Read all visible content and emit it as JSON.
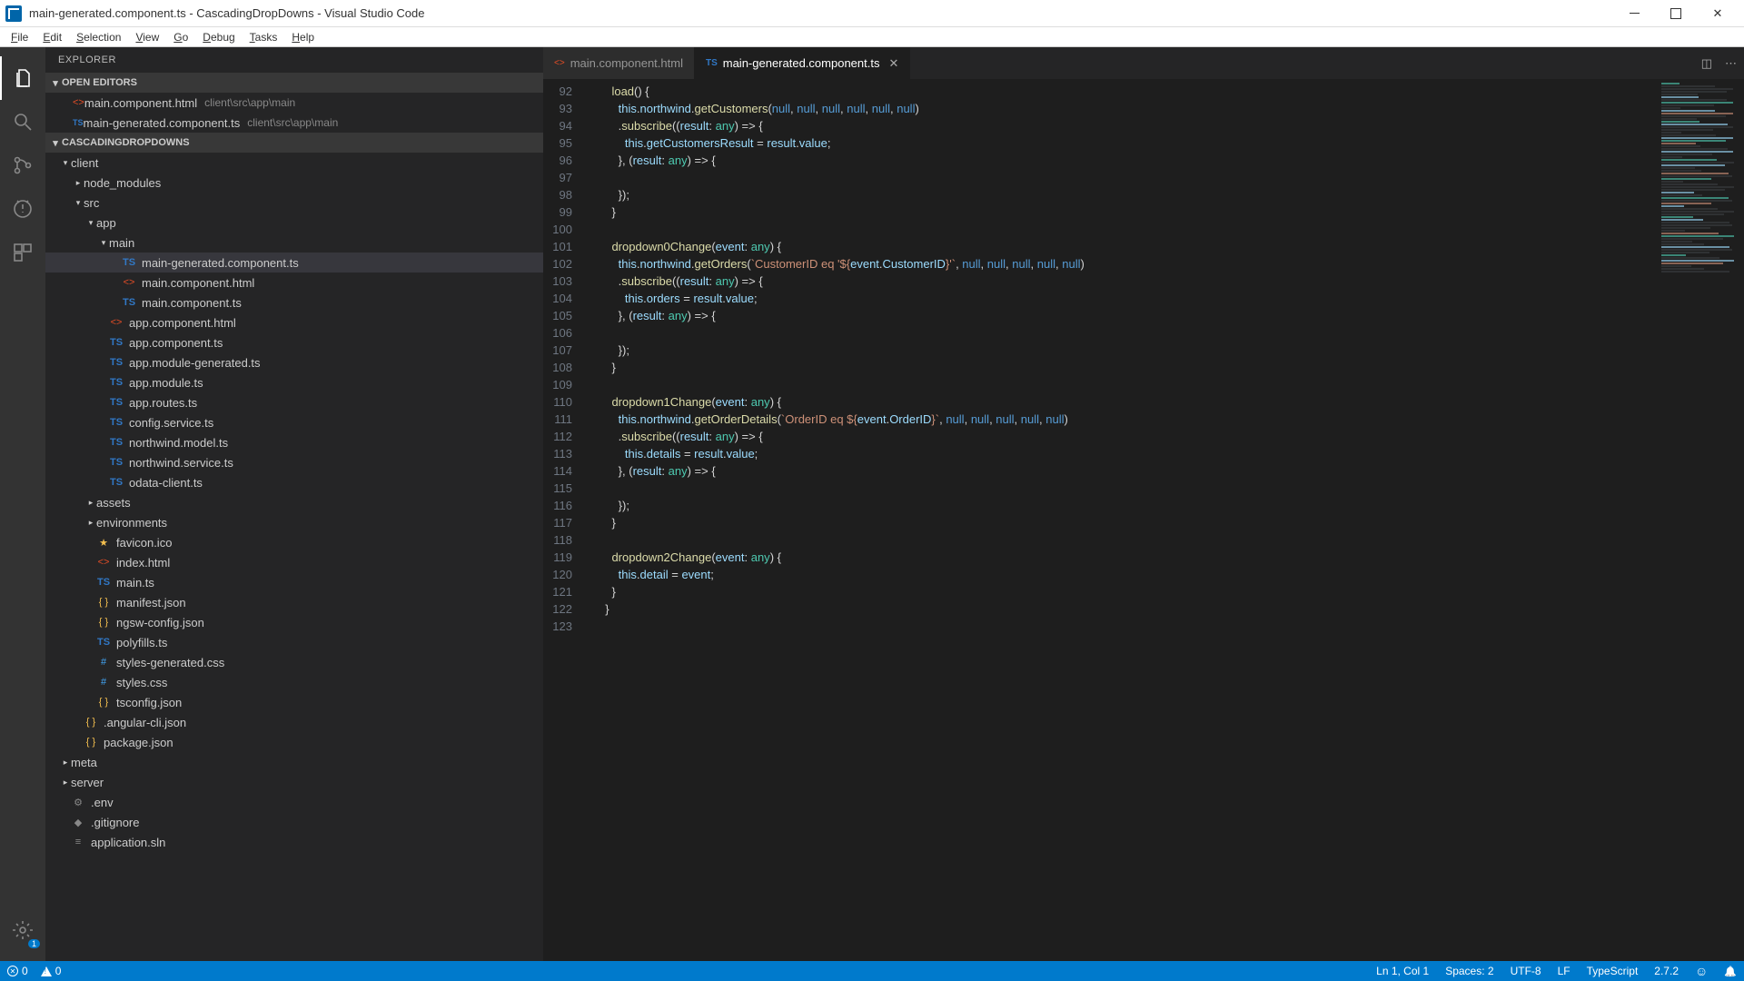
{
  "window": {
    "title": "main-generated.component.ts - CascadingDropDowns - Visual Studio Code"
  },
  "menubar": [
    "File",
    "Edit",
    "Selection",
    "View",
    "Go",
    "Debug",
    "Tasks",
    "Help"
  ],
  "activitybar": {
    "gear_badge": "1"
  },
  "sidebar": {
    "title": "EXPLORER",
    "open_editors_label": "OPEN EDITORS",
    "open_editors": [
      {
        "icon": "html",
        "name": "main.component.html",
        "desc": "client\\src\\app\\main"
      },
      {
        "icon": "ts",
        "name": "main-generated.component.ts",
        "desc": "client\\src\\app\\main"
      }
    ],
    "project_label": "CASCADINGDROPDOWNS",
    "tree": [
      {
        "indent": 0,
        "twisty": "▾",
        "icon": "",
        "name": "client",
        "kind": "folder"
      },
      {
        "indent": 1,
        "twisty": "▸",
        "icon": "",
        "name": "node_modules",
        "kind": "folder"
      },
      {
        "indent": 1,
        "twisty": "▾",
        "icon": "",
        "name": "src",
        "kind": "folder"
      },
      {
        "indent": 2,
        "twisty": "▾",
        "icon": "",
        "name": "app",
        "kind": "folder"
      },
      {
        "indent": 3,
        "twisty": "▾",
        "icon": "",
        "name": "main",
        "kind": "folder"
      },
      {
        "indent": 4,
        "twisty": "",
        "icon": "ts",
        "name": "main-generated.component.ts",
        "kind": "file",
        "active": true
      },
      {
        "indent": 4,
        "twisty": "",
        "icon": "html",
        "name": "main.component.html",
        "kind": "file"
      },
      {
        "indent": 4,
        "twisty": "",
        "icon": "ts",
        "name": "main.component.ts",
        "kind": "file"
      },
      {
        "indent": 3,
        "twisty": "",
        "icon": "html",
        "name": "app.component.html",
        "kind": "file"
      },
      {
        "indent": 3,
        "twisty": "",
        "icon": "ts",
        "name": "app.component.ts",
        "kind": "file"
      },
      {
        "indent": 3,
        "twisty": "",
        "icon": "ts",
        "name": "app.module-generated.ts",
        "kind": "file"
      },
      {
        "indent": 3,
        "twisty": "",
        "icon": "ts",
        "name": "app.module.ts",
        "kind": "file"
      },
      {
        "indent": 3,
        "twisty": "",
        "icon": "ts",
        "name": "app.routes.ts",
        "kind": "file"
      },
      {
        "indent": 3,
        "twisty": "",
        "icon": "ts",
        "name": "config.service.ts",
        "kind": "file"
      },
      {
        "indent": 3,
        "twisty": "",
        "icon": "ts",
        "name": "northwind.model.ts",
        "kind": "file"
      },
      {
        "indent": 3,
        "twisty": "",
        "icon": "ts",
        "name": "northwind.service.ts",
        "kind": "file"
      },
      {
        "indent": 3,
        "twisty": "",
        "icon": "ts",
        "name": "odata-client.ts",
        "kind": "file"
      },
      {
        "indent": 2,
        "twisty": "▸",
        "icon": "",
        "name": "assets",
        "kind": "folder"
      },
      {
        "indent": 2,
        "twisty": "▸",
        "icon": "",
        "name": "environments",
        "kind": "folder"
      },
      {
        "indent": 2,
        "twisty": "",
        "icon": "star",
        "name": "favicon.ico",
        "kind": "file"
      },
      {
        "indent": 2,
        "twisty": "",
        "icon": "html",
        "name": "index.html",
        "kind": "file"
      },
      {
        "indent": 2,
        "twisty": "",
        "icon": "ts",
        "name": "main.ts",
        "kind": "file"
      },
      {
        "indent": 2,
        "twisty": "",
        "icon": "json",
        "name": "manifest.json",
        "kind": "file"
      },
      {
        "indent": 2,
        "twisty": "",
        "icon": "json",
        "name": "ngsw-config.json",
        "kind": "file"
      },
      {
        "indent": 2,
        "twisty": "",
        "icon": "ts",
        "name": "polyfills.ts",
        "kind": "file"
      },
      {
        "indent": 2,
        "twisty": "",
        "icon": "css",
        "name": "styles-generated.css",
        "kind": "file"
      },
      {
        "indent": 2,
        "twisty": "",
        "icon": "css",
        "name": "styles.css",
        "kind": "file"
      },
      {
        "indent": 2,
        "twisty": "",
        "icon": "json",
        "name": "tsconfig.json",
        "kind": "file"
      },
      {
        "indent": 1,
        "twisty": "",
        "icon": "json",
        "name": ".angular-cli.json",
        "kind": "file"
      },
      {
        "indent": 1,
        "twisty": "",
        "icon": "json",
        "name": "package.json",
        "kind": "file"
      },
      {
        "indent": 0,
        "twisty": "▸",
        "icon": "",
        "name": "meta",
        "kind": "folder"
      },
      {
        "indent": 0,
        "twisty": "▸",
        "icon": "",
        "name": "server",
        "kind": "folder"
      },
      {
        "indent": 0,
        "twisty": "",
        "icon": "env",
        "name": ".env",
        "kind": "file"
      },
      {
        "indent": 0,
        "twisty": "",
        "icon": "git",
        "name": ".gitignore",
        "kind": "file"
      },
      {
        "indent": 0,
        "twisty": "",
        "icon": "sln",
        "name": "application.sln",
        "kind": "file"
      }
    ]
  },
  "tabs": [
    {
      "icon": "html",
      "name": "main.component.html",
      "active": false
    },
    {
      "icon": "ts",
      "name": "main-generated.component.ts",
      "active": true
    }
  ],
  "editor": {
    "first_line_no": 92,
    "lines": [
      {
        "t": [
          [
            "p",
            "    "
          ],
          [
            "fn",
            "load"
          ],
          [
            "p",
            "() {"
          ]
        ]
      },
      {
        "t": [
          [
            "p",
            "      "
          ],
          [
            "this",
            "this"
          ],
          [
            "p",
            "."
          ],
          [
            "v",
            "northwind"
          ],
          [
            "p",
            "."
          ],
          [
            "fn",
            "getCustomers"
          ],
          [
            "p",
            "("
          ],
          [
            "null",
            "null"
          ],
          [
            "p",
            ", "
          ],
          [
            "null",
            "null"
          ],
          [
            "p",
            ", "
          ],
          [
            "null",
            "null"
          ],
          [
            "p",
            ", "
          ],
          [
            "null",
            "null"
          ],
          [
            "p",
            ", "
          ],
          [
            "null",
            "null"
          ],
          [
            "p",
            ", "
          ],
          [
            "null",
            "null"
          ],
          [
            "p",
            ")"
          ]
        ]
      },
      {
        "t": [
          [
            "p",
            "      ."
          ],
          [
            "fn",
            "subscribe"
          ],
          [
            "p",
            "(("
          ],
          [
            "v",
            "result"
          ],
          [
            "p",
            ": "
          ],
          [
            "type",
            "any"
          ],
          [
            "p",
            ") => {"
          ]
        ]
      },
      {
        "t": [
          [
            "p",
            "        "
          ],
          [
            "this",
            "this"
          ],
          [
            "p",
            "."
          ],
          [
            "v",
            "getCustomersResult"
          ],
          [
            "p",
            " = "
          ],
          [
            "v",
            "result"
          ],
          [
            "p",
            "."
          ],
          [
            "v",
            "value"
          ],
          [
            "p",
            ";"
          ]
        ]
      },
      {
        "t": [
          [
            "p",
            "      }, ("
          ],
          [
            "v",
            "result"
          ],
          [
            "p",
            ": "
          ],
          [
            "type",
            "any"
          ],
          [
            "p",
            ") => {"
          ]
        ]
      },
      {
        "t": [
          [
            "p",
            ""
          ]
        ]
      },
      {
        "t": [
          [
            "p",
            "      });"
          ]
        ]
      },
      {
        "t": [
          [
            "p",
            "    }"
          ]
        ]
      },
      {
        "t": [
          [
            "p",
            ""
          ]
        ]
      },
      {
        "t": [
          [
            "p",
            "    "
          ],
          [
            "fn",
            "dropdown0Change"
          ],
          [
            "p",
            "("
          ],
          [
            "v",
            "event"
          ],
          [
            "p",
            ": "
          ],
          [
            "type",
            "any"
          ],
          [
            "p",
            ") {"
          ]
        ]
      },
      {
        "t": [
          [
            "p",
            "      "
          ],
          [
            "this",
            "this"
          ],
          [
            "p",
            "."
          ],
          [
            "v",
            "northwind"
          ],
          [
            "p",
            "."
          ],
          [
            "fn",
            "getOrders"
          ],
          [
            "p",
            "("
          ],
          [
            "str",
            "`CustomerID eq '${"
          ],
          [
            "v",
            "event"
          ],
          [
            "p",
            "."
          ],
          [
            "v",
            "CustomerID"
          ],
          [
            "str",
            "}'`"
          ],
          [
            "p",
            ", "
          ],
          [
            "null",
            "null"
          ],
          [
            "p",
            ", "
          ],
          [
            "null",
            "null"
          ],
          [
            "p",
            ", "
          ],
          [
            "null",
            "null"
          ],
          [
            "p",
            ", "
          ],
          [
            "null",
            "null"
          ],
          [
            "p",
            ", "
          ],
          [
            "null",
            "null"
          ],
          [
            "p",
            ")"
          ]
        ]
      },
      {
        "t": [
          [
            "p",
            "      ."
          ],
          [
            "fn",
            "subscribe"
          ],
          [
            "p",
            "(("
          ],
          [
            "v",
            "result"
          ],
          [
            "p",
            ": "
          ],
          [
            "type",
            "any"
          ],
          [
            "p",
            ") => {"
          ]
        ]
      },
      {
        "t": [
          [
            "p",
            "        "
          ],
          [
            "this",
            "this"
          ],
          [
            "p",
            "."
          ],
          [
            "v",
            "orders"
          ],
          [
            "p",
            " = "
          ],
          [
            "v",
            "result"
          ],
          [
            "p",
            "."
          ],
          [
            "v",
            "value"
          ],
          [
            "p",
            ";"
          ]
        ]
      },
      {
        "t": [
          [
            "p",
            "      }, ("
          ],
          [
            "v",
            "result"
          ],
          [
            "p",
            ": "
          ],
          [
            "type",
            "any"
          ],
          [
            "p",
            ") => {"
          ]
        ]
      },
      {
        "t": [
          [
            "p",
            ""
          ]
        ]
      },
      {
        "t": [
          [
            "p",
            "      });"
          ]
        ]
      },
      {
        "t": [
          [
            "p",
            "    }"
          ]
        ]
      },
      {
        "t": [
          [
            "p",
            ""
          ]
        ]
      },
      {
        "t": [
          [
            "p",
            "    "
          ],
          [
            "fn",
            "dropdown1Change"
          ],
          [
            "p",
            "("
          ],
          [
            "v",
            "event"
          ],
          [
            "p",
            ": "
          ],
          [
            "type",
            "any"
          ],
          [
            "p",
            ") {"
          ]
        ]
      },
      {
        "t": [
          [
            "p",
            "      "
          ],
          [
            "this",
            "this"
          ],
          [
            "p",
            "."
          ],
          [
            "v",
            "northwind"
          ],
          [
            "p",
            "."
          ],
          [
            "fn",
            "getOrderDetails"
          ],
          [
            "p",
            "("
          ],
          [
            "str",
            "`OrderID eq ${"
          ],
          [
            "v",
            "event"
          ],
          [
            "p",
            "."
          ],
          [
            "v",
            "OrderID"
          ],
          [
            "str",
            "}`"
          ],
          [
            "p",
            ", "
          ],
          [
            "null",
            "null"
          ],
          [
            "p",
            ", "
          ],
          [
            "null",
            "null"
          ],
          [
            "p",
            ", "
          ],
          [
            "null",
            "null"
          ],
          [
            "p",
            ", "
          ],
          [
            "null",
            "null"
          ],
          [
            "p",
            ", "
          ],
          [
            "null",
            "null"
          ],
          [
            "p",
            ")"
          ]
        ]
      },
      {
        "t": [
          [
            "p",
            "      ."
          ],
          [
            "fn",
            "subscribe"
          ],
          [
            "p",
            "(("
          ],
          [
            "v",
            "result"
          ],
          [
            "p",
            ": "
          ],
          [
            "type",
            "any"
          ],
          [
            "p",
            ") => {"
          ]
        ]
      },
      {
        "t": [
          [
            "p",
            "        "
          ],
          [
            "this",
            "this"
          ],
          [
            "p",
            "."
          ],
          [
            "v",
            "details"
          ],
          [
            "p",
            " = "
          ],
          [
            "v",
            "result"
          ],
          [
            "p",
            "."
          ],
          [
            "v",
            "value"
          ],
          [
            "p",
            ";"
          ]
        ]
      },
      {
        "t": [
          [
            "p",
            "      }, ("
          ],
          [
            "v",
            "result"
          ],
          [
            "p",
            ": "
          ],
          [
            "type",
            "any"
          ],
          [
            "p",
            ") => {"
          ]
        ]
      },
      {
        "t": [
          [
            "p",
            ""
          ]
        ]
      },
      {
        "t": [
          [
            "p",
            "      });"
          ]
        ]
      },
      {
        "t": [
          [
            "p",
            "    }"
          ]
        ]
      },
      {
        "t": [
          [
            "p",
            ""
          ]
        ]
      },
      {
        "t": [
          [
            "p",
            "    "
          ],
          [
            "fn",
            "dropdown2Change"
          ],
          [
            "p",
            "("
          ],
          [
            "v",
            "event"
          ],
          [
            "p",
            ": "
          ],
          [
            "type",
            "any"
          ],
          [
            "p",
            ") {"
          ]
        ]
      },
      {
        "t": [
          [
            "p",
            "      "
          ],
          [
            "this",
            "this"
          ],
          [
            "p",
            "."
          ],
          [
            "v",
            "detail"
          ],
          [
            "p",
            " = "
          ],
          [
            "v",
            "event"
          ],
          [
            "p",
            ";"
          ]
        ]
      },
      {
        "t": [
          [
            "p",
            "    }"
          ]
        ]
      },
      {
        "t": [
          [
            "p",
            "  }"
          ]
        ]
      },
      {
        "t": [
          [
            "p",
            ""
          ]
        ]
      }
    ]
  },
  "statusbar": {
    "errors": "0",
    "warnings": "0",
    "ln_col": "Ln 1, Col 1",
    "spaces": "Spaces: 2",
    "encoding": "UTF-8",
    "eol": "LF",
    "language": "TypeScript",
    "version": "2.7.2"
  }
}
